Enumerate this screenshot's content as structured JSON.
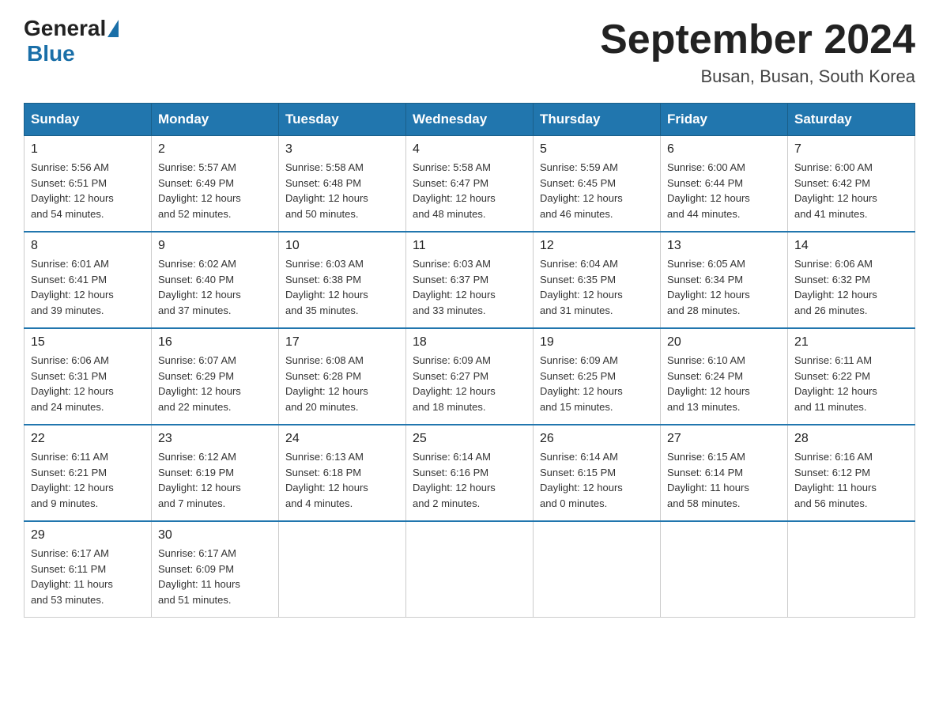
{
  "logo": {
    "general": "General",
    "blue": "Blue"
  },
  "title": "September 2024",
  "location": "Busan, Busan, South Korea",
  "weekdays": [
    "Sunday",
    "Monday",
    "Tuesday",
    "Wednesday",
    "Thursday",
    "Friday",
    "Saturday"
  ],
  "weeks": [
    [
      {
        "day": "1",
        "sunrise": "5:56 AM",
        "sunset": "6:51 PM",
        "daylight": "12 hours and 54 minutes."
      },
      {
        "day": "2",
        "sunrise": "5:57 AM",
        "sunset": "6:49 PM",
        "daylight": "12 hours and 52 minutes."
      },
      {
        "day": "3",
        "sunrise": "5:58 AM",
        "sunset": "6:48 PM",
        "daylight": "12 hours and 50 minutes."
      },
      {
        "day": "4",
        "sunrise": "5:58 AM",
        "sunset": "6:47 PM",
        "daylight": "12 hours and 48 minutes."
      },
      {
        "day": "5",
        "sunrise": "5:59 AM",
        "sunset": "6:45 PM",
        "daylight": "12 hours and 46 minutes."
      },
      {
        "day": "6",
        "sunrise": "6:00 AM",
        "sunset": "6:44 PM",
        "daylight": "12 hours and 44 minutes."
      },
      {
        "day": "7",
        "sunrise": "6:00 AM",
        "sunset": "6:42 PM",
        "daylight": "12 hours and 41 minutes."
      }
    ],
    [
      {
        "day": "8",
        "sunrise": "6:01 AM",
        "sunset": "6:41 PM",
        "daylight": "12 hours and 39 minutes."
      },
      {
        "day": "9",
        "sunrise": "6:02 AM",
        "sunset": "6:40 PM",
        "daylight": "12 hours and 37 minutes."
      },
      {
        "day": "10",
        "sunrise": "6:03 AM",
        "sunset": "6:38 PM",
        "daylight": "12 hours and 35 minutes."
      },
      {
        "day": "11",
        "sunrise": "6:03 AM",
        "sunset": "6:37 PM",
        "daylight": "12 hours and 33 minutes."
      },
      {
        "day": "12",
        "sunrise": "6:04 AM",
        "sunset": "6:35 PM",
        "daylight": "12 hours and 31 minutes."
      },
      {
        "day": "13",
        "sunrise": "6:05 AM",
        "sunset": "6:34 PM",
        "daylight": "12 hours and 28 minutes."
      },
      {
        "day": "14",
        "sunrise": "6:06 AM",
        "sunset": "6:32 PM",
        "daylight": "12 hours and 26 minutes."
      }
    ],
    [
      {
        "day": "15",
        "sunrise": "6:06 AM",
        "sunset": "6:31 PM",
        "daylight": "12 hours and 24 minutes."
      },
      {
        "day": "16",
        "sunrise": "6:07 AM",
        "sunset": "6:29 PM",
        "daylight": "12 hours and 22 minutes."
      },
      {
        "day": "17",
        "sunrise": "6:08 AM",
        "sunset": "6:28 PM",
        "daylight": "12 hours and 20 minutes."
      },
      {
        "day": "18",
        "sunrise": "6:09 AM",
        "sunset": "6:27 PM",
        "daylight": "12 hours and 18 minutes."
      },
      {
        "day": "19",
        "sunrise": "6:09 AM",
        "sunset": "6:25 PM",
        "daylight": "12 hours and 15 minutes."
      },
      {
        "day": "20",
        "sunrise": "6:10 AM",
        "sunset": "6:24 PM",
        "daylight": "12 hours and 13 minutes."
      },
      {
        "day": "21",
        "sunrise": "6:11 AM",
        "sunset": "6:22 PM",
        "daylight": "12 hours and 11 minutes."
      }
    ],
    [
      {
        "day": "22",
        "sunrise": "6:11 AM",
        "sunset": "6:21 PM",
        "daylight": "12 hours and 9 minutes."
      },
      {
        "day": "23",
        "sunrise": "6:12 AM",
        "sunset": "6:19 PM",
        "daylight": "12 hours and 7 minutes."
      },
      {
        "day": "24",
        "sunrise": "6:13 AM",
        "sunset": "6:18 PM",
        "daylight": "12 hours and 4 minutes."
      },
      {
        "day": "25",
        "sunrise": "6:14 AM",
        "sunset": "6:16 PM",
        "daylight": "12 hours and 2 minutes."
      },
      {
        "day": "26",
        "sunrise": "6:14 AM",
        "sunset": "6:15 PM",
        "daylight": "12 hours and 0 minutes."
      },
      {
        "day": "27",
        "sunrise": "6:15 AM",
        "sunset": "6:14 PM",
        "daylight": "11 hours and 58 minutes."
      },
      {
        "day": "28",
        "sunrise": "6:16 AM",
        "sunset": "6:12 PM",
        "daylight": "11 hours and 56 minutes."
      }
    ],
    [
      {
        "day": "29",
        "sunrise": "6:17 AM",
        "sunset": "6:11 PM",
        "daylight": "11 hours and 53 minutes."
      },
      {
        "day": "30",
        "sunrise": "6:17 AM",
        "sunset": "6:09 PM",
        "daylight": "11 hours and 51 minutes."
      },
      null,
      null,
      null,
      null,
      null
    ]
  ],
  "labels": {
    "sunrise": "Sunrise:",
    "sunset": "Sunset:",
    "daylight": "Daylight:"
  }
}
